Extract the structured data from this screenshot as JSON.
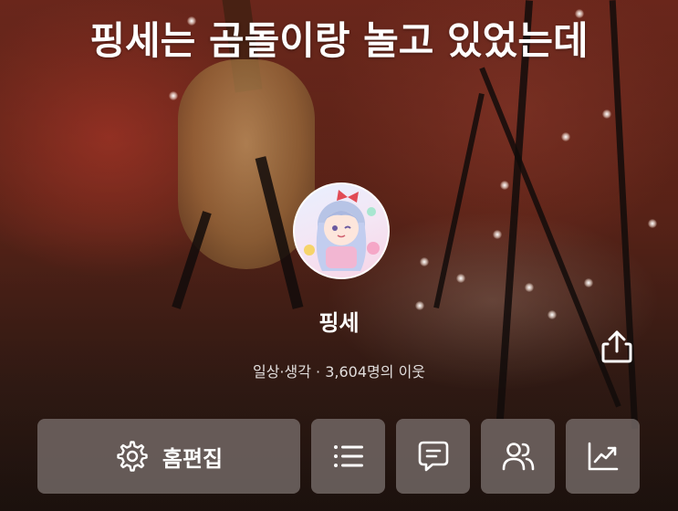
{
  "profile": {
    "title": "핑세는 곰돌이랑 놀고 있었는데",
    "nickname": "핑세",
    "category": "일상·생각",
    "separator": "·",
    "neighbors": "3,604명의 이웃"
  },
  "actions": {
    "home_edit_label": "홈편집",
    "icons": [
      "gear-icon",
      "list-icon",
      "message-icon",
      "people-icon",
      "stats-icon",
      "share-icon"
    ]
  }
}
